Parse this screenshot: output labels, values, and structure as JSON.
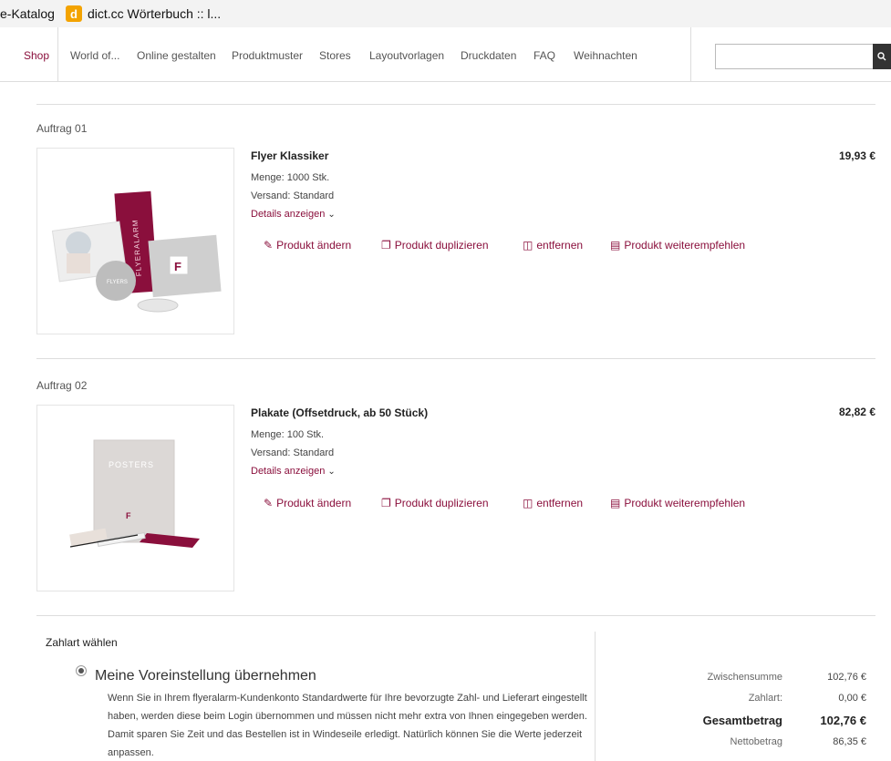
{
  "browser": {
    "bookmark_1": "e-Katalog",
    "bookmark_2": "dict.cc Wörterbuch :: l...",
    "bookmark_2_icon": "d"
  },
  "nav": {
    "items": [
      "Shop",
      "World of...",
      "Online gestalten",
      "Produktmuster",
      "Stores",
      "Layoutvorlagen",
      "Druckdaten",
      "FAQ",
      "Weihnachten"
    ],
    "search_placeholder": "",
    "search_icon": "magnifier-icon"
  },
  "orders": [
    {
      "label": "Auftrag 01",
      "title": "Flyer Klassiker",
      "menge": "Menge: 1000 Stk.",
      "versand": "Versand: Standard",
      "details": "Details anzeigen",
      "price": "19,93 €",
      "image_texts": [
        "FLYERALARM",
        "FLYERS",
        "F"
      ]
    },
    {
      "label": "Auftrag 02",
      "title": "Plakate (Offsetdruck, ab 50 Stück)",
      "menge": "Menge: 100 Stk.",
      "versand": "Versand: Standard",
      "details": "Details anzeigen",
      "price": "82,82 €",
      "image_texts": [
        "POSTERS",
        "F"
      ]
    }
  ],
  "actions": {
    "change": "Produkt ändern",
    "duplicate": "Produkt duplizieren",
    "remove": "entfernen",
    "recommend": "Produkt weiterempfehlen"
  },
  "payment": {
    "title": "Zahlart wählen",
    "option_label": "Meine Voreinstellung übernehmen",
    "description": "Wenn Sie in Ihrem flyeralarm-Kundenkonto Standardwerte für Ihre bevorzugte Zahl- und Lieferart eingestellt haben, werden diese beim Login übernommen und müssen nicht mehr extra von Ihnen eingegeben werden. Damit sparen Sie Zeit und das Bestellen ist in Windeseile erledigt. Natürlich können Sie die Werte jederzeit anpassen."
  },
  "summary": {
    "subtotal_label": "Zwischensumme",
    "subtotal_value": "102,76 €",
    "payment_label": "Zahlart:",
    "payment_value": "0,00 €",
    "total_label": "Gesamtbetrag",
    "total_value": "102,76 €",
    "net_label": "Nettobetrag",
    "net_value": "86,35 €"
  },
  "colors": {
    "accent": "#8a0f3c"
  }
}
